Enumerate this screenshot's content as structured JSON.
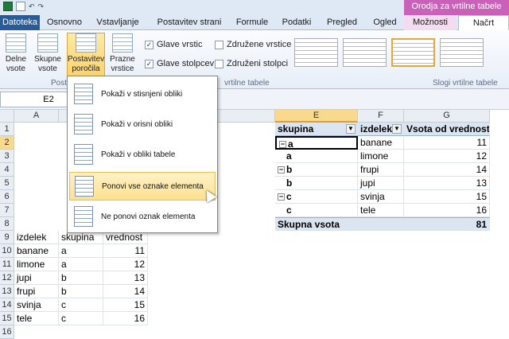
{
  "contextual_tab": "Orodja za vrtilne tabele",
  "tabs": [
    "Datoteka",
    "Osnovno",
    "Vstavljanje",
    "Postavitev strani",
    "Formule",
    "Podatki",
    "Pregled",
    "Ogled",
    "Možnosti",
    "Načrt"
  ],
  "ribbon": {
    "subtotals": "Delne vsote",
    "grand_totals": "Skupne vsote",
    "report_layout": "Postavitev poročila",
    "blank_rows": "Prazne vrstice",
    "row_headers": "Glave vrstic",
    "column_headers": "Glave stolpcev",
    "banded_rows": "Združene vrstice",
    "banded_columns": "Združeni stolpci",
    "group_layout": "Post",
    "group_options": "vrtilne tabele",
    "group_styles": "Slogi vrtilne tabele"
  },
  "name_box": "E2",
  "menu": [
    "Pokaži v stisnjeni obliki",
    "Pokaži v orisni obliki",
    "Pokaži v obliki tabele",
    "Ponovi vse oznake elementa",
    "Ne ponovi oznak elementa"
  ],
  "columns": [
    "A",
    "E",
    "F",
    "G"
  ],
  "rows": [
    "1",
    "2",
    "3",
    "4",
    "5",
    "6",
    "7",
    "8",
    "9",
    "10",
    "11",
    "12",
    "13",
    "14",
    "15",
    "16"
  ],
  "source_table": {
    "headers": [
      "izdelek",
      "skupina",
      "vrednost"
    ],
    "rows": [
      [
        "banane",
        "a",
        "11"
      ],
      [
        "limone",
        "a",
        "12"
      ],
      [
        "jupi",
        "b",
        "13"
      ],
      [
        "frupi",
        "b",
        "14"
      ],
      [
        "svinja",
        "c",
        "15"
      ],
      [
        "tele",
        "c",
        "16"
      ]
    ]
  },
  "pivot": {
    "headers": [
      "skupina",
      "izdelek",
      "Vsota od vrednost"
    ],
    "rows": [
      [
        "a",
        "banane",
        "11"
      ],
      [
        "a",
        "limone",
        "12"
      ],
      [
        "b",
        "frupi",
        "14"
      ],
      [
        "b",
        "jupi",
        "13"
      ],
      [
        "c",
        "svinja",
        "15"
      ],
      [
        "c",
        "tele",
        "16"
      ]
    ],
    "total_label": "Skupna vsota",
    "total_value": "81"
  }
}
